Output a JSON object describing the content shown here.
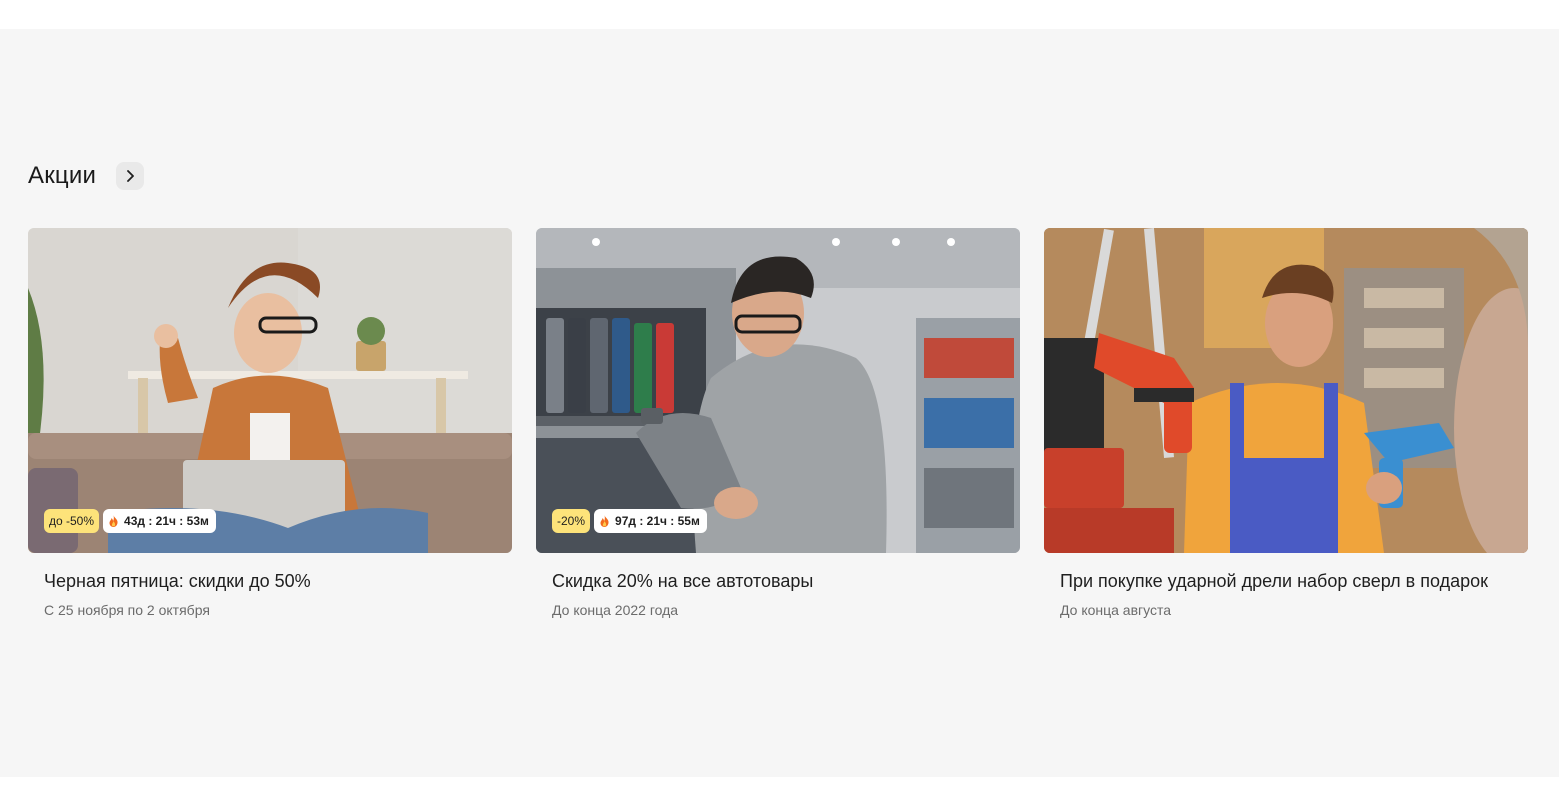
{
  "section": {
    "title": "Акции",
    "more_icon": "chevron-right-icon"
  },
  "promos": [
    {
      "discount": "до -50%",
      "timer": "43д : 21ч : 53м",
      "timer_icon": "fire-icon",
      "title": "Черная пятница: скидки до 50%",
      "period": "С 25 ноября по 2 октября"
    },
    {
      "discount": "-20%",
      "timer": "97д : 21ч : 55м",
      "timer_icon": "fire-icon",
      "title": "Скидка 20% на все автотовары",
      "period": "До конца 2022 года"
    },
    {
      "title": "При покупке ударной дрели набор сверл в подарок",
      "period": "До конца августа"
    }
  ],
  "colors": {
    "background": "#f6f6f6",
    "discount_badge": "#fde37a",
    "fire": "#f26b1d"
  }
}
